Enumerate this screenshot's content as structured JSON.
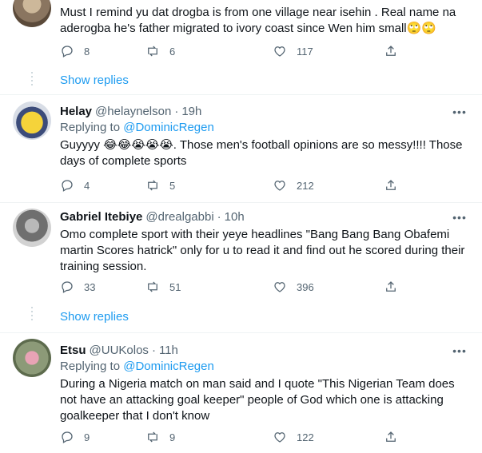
{
  "tweets": [
    {
      "text": "Must I remind yu dat drogba is from one village near isehin .  Real name na aderogba he's father migrated to ivory coast since Wen him small🙄🙄",
      "replies": "8",
      "retweets": "6",
      "likes": "117",
      "show_replies": "Show replies"
    },
    {
      "name": "Helay",
      "handle": "@helaynelson",
      "dot": "·",
      "time": "19h",
      "replying_prefix": "Replying to",
      "replying_to": "@DominicRegen",
      "text": "Guyyyy 😂😂😭😭😭. Those men's football opinions are so messy!!!! Those days of complete sports",
      "replies": "4",
      "retweets": "5",
      "likes": "212"
    },
    {
      "name": "Gabriel Itebiye",
      "handle": "@drealgabbi",
      "dot": "·",
      "time": "10h",
      "text": "Omo complete sport with their yeye headlines \"Bang Bang Bang Obafemi martin Scores hatrick\" only for u to read it and find out he scored during their training session.",
      "replies": "33",
      "retweets": "51",
      "likes": "396",
      "show_replies": "Show replies"
    },
    {
      "name": "Etsu",
      "handle": "@UUKolos",
      "dot": "·",
      "time": "11h",
      "replying_prefix": "Replying to",
      "replying_to": "@DominicRegen",
      "text": "During a Nigeria match on man said and I quote \"This Nigerian Team does not have an attacking goal keeper\" people of God which one is attacking goalkeeper that I don't know",
      "replies": "9",
      "retweets": "9",
      "likes": "122"
    }
  ],
  "icons": {
    "reply": "reply-icon",
    "retweet": "retweet-icon",
    "like": "heart-icon",
    "share": "share-icon",
    "more": "more-icon"
  },
  "colors": {
    "accent": "#1d9bf0",
    "secondary_text": "#536471",
    "divider": "#eff3f4"
  }
}
